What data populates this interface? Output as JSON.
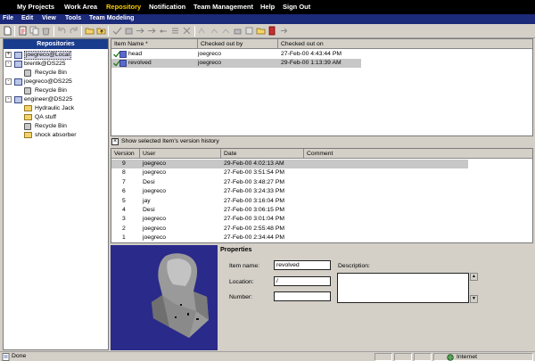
{
  "top_nav": {
    "items": [
      "My Projects",
      "Work Area",
      "Repository",
      "Notification",
      "Team Management",
      "Help",
      "Sign Out"
    ],
    "active": "Repository"
  },
  "menu": {
    "items": [
      "File",
      "Edit",
      "View",
      "Tools",
      "Team Modeling"
    ]
  },
  "toolbar": {
    "icons": [
      "new-icon",
      "open-icon",
      "copy-icon",
      "delete-icon",
      "undo-icon",
      "redo-icon",
      "folder-open-icon",
      "folder-up-icon",
      "checkin-icon",
      "checkout-icon",
      "move-icon",
      "history-icon",
      "link-icon",
      "tools-icon",
      "blank-icon",
      "unlink-icon",
      "flag-icon",
      "properties-icon",
      "lock-icon",
      "label-icon",
      "report-icon",
      "export-icon"
    ]
  },
  "repositories": {
    "header": "Repositories",
    "tree": [
      {
        "label": "joegreco@Local",
        "level": 0,
        "kind": "repo",
        "expander": "+",
        "selected": true
      },
      {
        "label": "brentk@DS225",
        "level": 0,
        "kind": "repo",
        "expander": "-"
      },
      {
        "label": "Recycle Bin",
        "level": 1,
        "kind": "bin"
      },
      {
        "label": "joegreco@DS225",
        "level": 0,
        "kind": "repo",
        "expander": "-"
      },
      {
        "label": "Recycle Bin",
        "level": 1,
        "kind": "bin"
      },
      {
        "label": "engineer@DS225",
        "level": 0,
        "kind": "repo",
        "expander": "-"
      },
      {
        "label": "Hydraulic Jack",
        "level": 1,
        "kind": "folder"
      },
      {
        "label": "QA stuff",
        "level": 1,
        "kind": "folder"
      },
      {
        "label": "Recycle Bin",
        "level": 1,
        "kind": "bin"
      },
      {
        "label": "shock absorber",
        "level": 1,
        "kind": "folder"
      }
    ]
  },
  "item_list": {
    "columns": [
      "Item Name *",
      "Checked out by",
      "Checked out on"
    ],
    "rows": [
      {
        "name": "head",
        "checked_out_by": "joegreco",
        "checked_out_on": "27-Feb-00 4:43:44 PM",
        "selected": false
      },
      {
        "name": "revolved",
        "checked_out_by": "joegreco",
        "checked_out_on": "29-Feb-00 1:13:39 AM",
        "selected": true
      }
    ]
  },
  "history_toggle": {
    "label": "Show selected Item's version history",
    "checked": true
  },
  "version_list": {
    "columns": [
      "Version",
      "User",
      "Date",
      "Comment"
    ],
    "rows": [
      {
        "version": "9",
        "user": "joegreco",
        "date": "29-Feb-00 4:02:13 AM",
        "comment": "",
        "selected": true
      },
      {
        "version": "8",
        "user": "joegreco",
        "date": "27-Feb-00 3:51:54 PM",
        "comment": ""
      },
      {
        "version": "7",
        "user": "Desi",
        "date": "27-Feb-00 3:48:27 PM",
        "comment": ""
      },
      {
        "version": "6",
        "user": "joegreco",
        "date": "27-Feb-00 3:24:33 PM",
        "comment": ""
      },
      {
        "version": "5",
        "user": "jay",
        "date": "27-Feb-00 3:16:04 PM",
        "comment": ""
      },
      {
        "version": "4",
        "user": "Desi",
        "date": "27-Feb-00 3:06:15 PM",
        "comment": ""
      },
      {
        "version": "3",
        "user": "joegreco",
        "date": "27-Feb-00 3:01:04 PM",
        "comment": ""
      },
      {
        "version": "2",
        "user": "joegreco",
        "date": "27-Feb-00 2:55:48 PM",
        "comment": ""
      },
      {
        "version": "1",
        "user": "joegreco",
        "date": "27-Feb-00 2:34:44 PM",
        "comment": ""
      }
    ]
  },
  "properties": {
    "title": "Properties",
    "item_name_label": "Item name:",
    "item_name_value": "revolved",
    "location_label": "Location:",
    "location_value": "/",
    "number_label": "Number:",
    "number_value": "",
    "description_label": "Description:",
    "description_value": ""
  },
  "status_bar": {
    "left_text": "Done",
    "zone_text": "Internet"
  },
  "colors": {
    "nav_bg": "#000000",
    "nav_active": "#ffcc00",
    "menu_bg": "#1c2a7a",
    "tree_header": "#1a3c8c",
    "preview_bg": "#2a2a8a",
    "selected_row": "#c7c7c7"
  }
}
